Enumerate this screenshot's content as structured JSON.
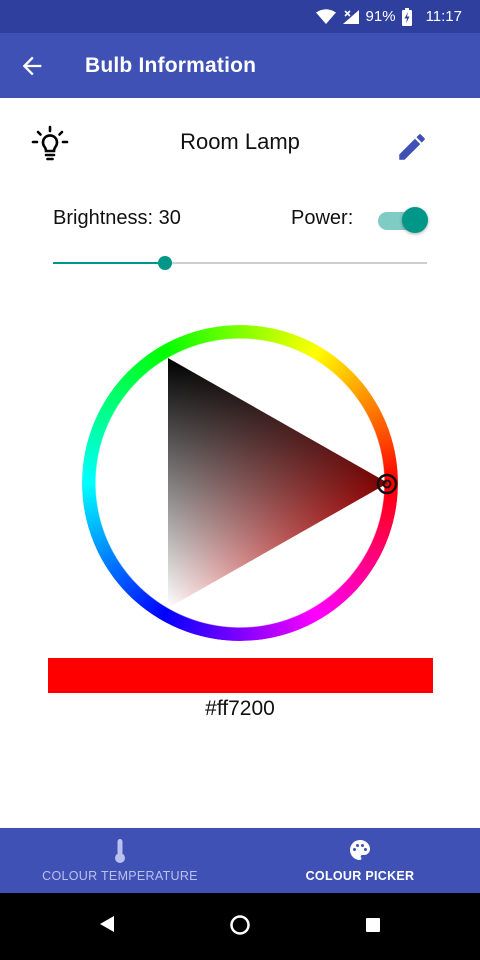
{
  "status_bar": {
    "battery": "91%",
    "time": "11:17"
  },
  "app_bar": {
    "title": "Bulb Information",
    "back_icon": "arrow-back-icon"
  },
  "bulb": {
    "name": "Room Lamp",
    "bulb_icon": "lightbulb-icon",
    "edit_icon": "pencil-icon",
    "brightness_label": "Brightness: 30",
    "brightness_value": 30,
    "brightness_fraction": 0.3,
    "power_label": "Power:",
    "power_on": true
  },
  "color_picker": {
    "selected_color": "#ff0000",
    "hex_label": "#ff7200",
    "wheel_colors": [
      "#ff0000",
      "#ffff00",
      "#00ff00",
      "#00ffff",
      "#0000ff",
      "#ff00ff"
    ]
  },
  "bottom_nav": {
    "tabs": [
      {
        "label": "COLOUR TEMPERATURE",
        "icon": "thermometer-icon",
        "active": false
      },
      {
        "label": "COLOUR PICKER",
        "icon": "palette-icon",
        "active": true
      }
    ]
  },
  "system_nav": {
    "back": "nav-back-icon",
    "home": "nav-home-icon",
    "recents": "nav-recents-icon"
  },
  "colors": {
    "primary": "#3f51b5",
    "primary_dark": "#2f3f9e",
    "accent": "#009688",
    "accent_light": "#80cbc4"
  }
}
